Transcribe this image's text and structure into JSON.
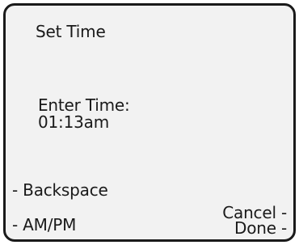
{
  "screen": {
    "title": "Set Time",
    "prompt_label": "Enter Time:",
    "prompt_value": "01:13am"
  },
  "softkeys": {
    "left": [
      {
        "label": "- Backspace"
      },
      {
        "label": "- AM/PM"
      }
    ],
    "right": [
      {
        "label": "Cancel -"
      },
      {
        "label": "Done -"
      }
    ]
  },
  "colors": {
    "screen_background": "#f2f2f2",
    "border": "#1a1a1a",
    "text": "#1a1a1a"
  }
}
